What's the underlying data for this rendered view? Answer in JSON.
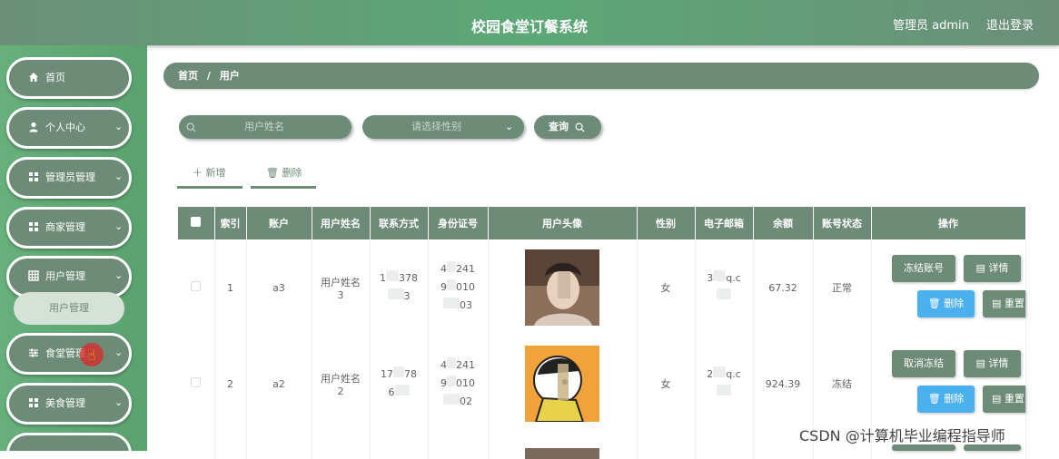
{
  "header": {
    "title": "校园食堂订餐系统",
    "user": "管理员 admin",
    "logout": "退出登录"
  },
  "sidebar": {
    "items": [
      {
        "label": "首页",
        "icon": "home-icon"
      },
      {
        "label": "个人中心",
        "icon": "person-icon"
      },
      {
        "label": "管理员管理",
        "icon": "grid-icon"
      },
      {
        "label": "商家管理",
        "icon": "grid-icon"
      },
      {
        "label": "用户管理",
        "icon": "grid-icon"
      },
      {
        "label": "食堂管理",
        "icon": "sliders-icon"
      },
      {
        "label": "美食管理",
        "icon": "grid-icon"
      }
    ],
    "submenu": "用户管理"
  },
  "breadcrumb": {
    "home": "首页",
    "sep": "/",
    "current": "用户"
  },
  "filters": {
    "name_placeholder": "用户姓名",
    "gender_placeholder": "请选择性别",
    "query": "查询"
  },
  "actions": {
    "add": "新增",
    "delete": "删除"
  },
  "table": {
    "columns": [
      "索引",
      "账户",
      "用户姓名",
      "联系方式",
      "身份证号",
      "用户头像",
      "性别",
      "电子邮箱",
      "余额",
      "账号状态",
      "操作"
    ],
    "rows": [
      {
        "index": "1",
        "account": "a3",
        "name_line1": "用户姓名",
        "name_line2": "3",
        "phone_a": "1",
        "phone_b": "378",
        "phone_c": "3",
        "id_a": "4",
        "id_b": "241",
        "id_c": "9",
        "id_d": "010",
        "id_e": "03",
        "gender": "女",
        "email_a": "3",
        "email_b": "q.c",
        "balance": "67.32",
        "status": "正常",
        "toggle": "冻结账号",
        "detail": "详情",
        "delete": "删除",
        "reset": "重置"
      },
      {
        "index": "2",
        "account": "a2",
        "name_line1": "用户姓名",
        "name_line2": "2",
        "phone_a": "17",
        "phone_b": "78",
        "phone_c": "6",
        "id_a": "4",
        "id_b": "241",
        "id_c": "9",
        "id_d": "010",
        "id_e": "02",
        "gender": "女",
        "email_a": "2",
        "email_b": "q.c",
        "balance": "924.39",
        "status": "冻结",
        "toggle": "取消冻结",
        "detail": "详情",
        "delete": "删除",
        "reset": "重置"
      }
    ]
  },
  "watermark": "CSDN @计算机毕业编程指导师",
  "colors": {
    "primary": "#6d8b77",
    "sidebar": "#5ca877",
    "blue": "#4ab0ee"
  }
}
